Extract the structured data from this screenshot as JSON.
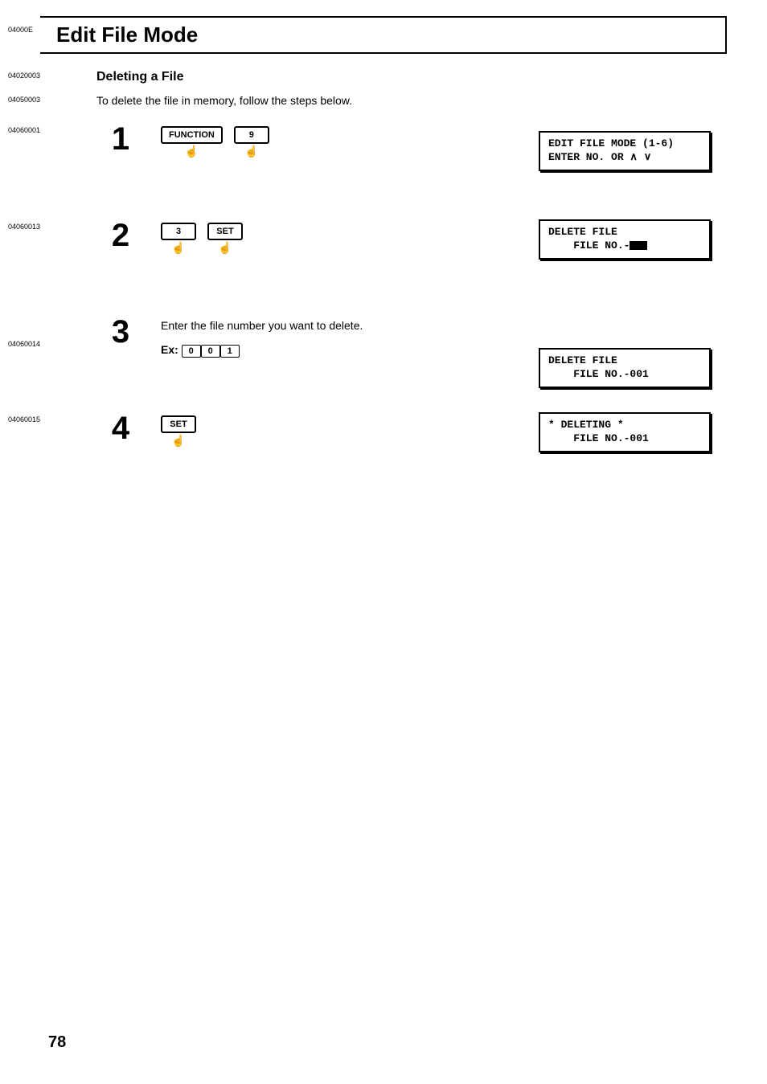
{
  "header": {
    "code": "04000E",
    "title": "Edit File Mode"
  },
  "section": {
    "code": "04020003",
    "title": "Deleting a File"
  },
  "intro": {
    "code": "04050003",
    "text": "To delete the file in memory, follow the steps below."
  },
  "steps": [
    {
      "code": "04060001",
      "num": "1",
      "keys": [
        "FUNCTION",
        "9"
      ],
      "display": "EDIT FILE MODE (1-6)\nENTER NO. OR ∧ ∨"
    },
    {
      "code": "04060013",
      "num": "2",
      "keys": [
        "3",
        "SET"
      ],
      "display": "DELETE FILE\n    FILE NO.-"
    },
    {
      "code": "04060014",
      "num": "3",
      "text": "Enter the file number you want to delete.",
      "ex_label": "Ex:",
      "ex_keys": [
        "0",
        "0",
        "1"
      ],
      "display": "DELETE FILE\n    FILE NO.-001"
    },
    {
      "code": "04060015",
      "num": "4",
      "keys": [
        "SET"
      ],
      "display": "* DELETING *\n    FILE NO.-001"
    }
  ],
  "page_number": "78"
}
